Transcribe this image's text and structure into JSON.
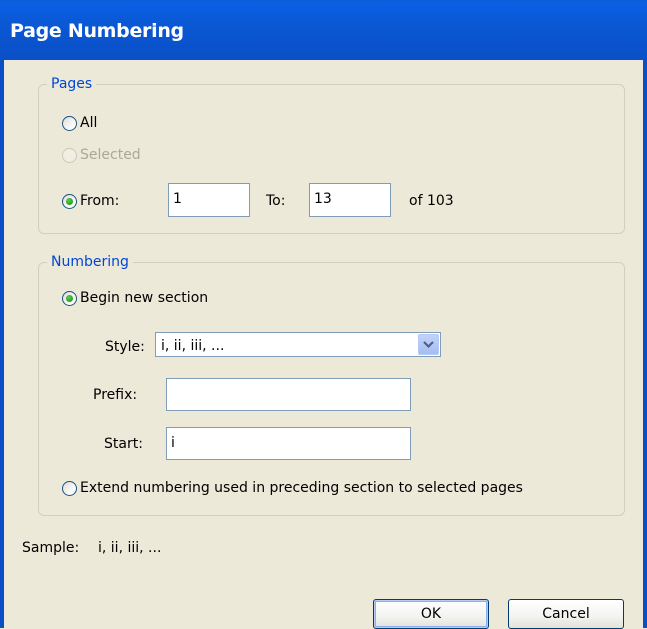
{
  "dialog": {
    "title": "Page Numbering"
  },
  "pages": {
    "legend": "Pages",
    "all_label": "All",
    "selected_label": "Selected",
    "from_label": "From:",
    "from_value": "1",
    "to_label": "To:",
    "to_value": "13",
    "of_text": "of 103",
    "selected_option": "from"
  },
  "numbering": {
    "legend": "Numbering",
    "begin_label": "Begin new section",
    "style_label": "Style:",
    "style_value": "i, ii, iii, ...",
    "prefix_label": "Prefix:",
    "prefix_value": "",
    "start_label": "Start:",
    "start_value": "i",
    "extend_label": "Extend numbering used in preceding section to selected pages",
    "selected_option": "begin"
  },
  "sample": {
    "label": "Sample:",
    "value": "i, ii, iii, ..."
  },
  "buttons": {
    "ok_label": "OK",
    "cancel_label": "Cancel"
  },
  "colors": {
    "titlebar": "#0A58D3",
    "legend_text": "#0046D5",
    "dialog_bg": "#ECE9D8",
    "radio_dot": "#21A121"
  }
}
